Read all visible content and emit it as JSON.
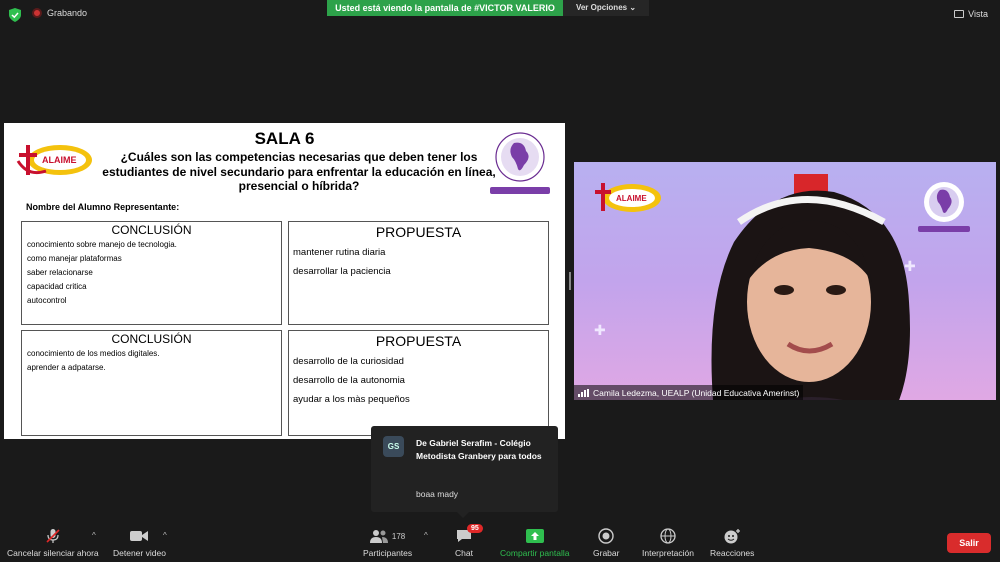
{
  "topbar": {
    "recording_label": "Grabando",
    "share_banner": "Usted está viendo la pantalla de #VICTOR VALERIO",
    "view_options": "Ver Opciones",
    "view_label": "Vista"
  },
  "slide": {
    "title": "SALA 6",
    "question": "¿Cuáles son las competencias necesarias que deben tener los estudiantes de nivel secundario para enfrentar la educación en línea, presencial o híbrida?",
    "logo_text": "ALAIME",
    "student_label": "Nombre del Alumno Representante:",
    "boxes": [
      {
        "heading": "CONCLUSIÓN",
        "lines": [
          "conocimiento sobre manejo de tecnologia.",
          "como manejar plataformas",
          "saber relacionarse",
          "capacidad critica",
          "autocontrol"
        ]
      },
      {
        "heading": "PROPUESTA",
        "lines": [
          "mantener rutina diaria",
          "desarrollar la paciencia"
        ]
      },
      {
        "heading": "CONCLUSIÓN",
        "lines": [
          "conocimiento de los medios digitales.",
          "aprender a adpatarse."
        ]
      },
      {
        "heading": "PROPUESTA",
        "lines": [
          "desarrollo de la curiosidad",
          "desarrollo de la autonomia",
          "ayudar a los màs pequeños"
        ]
      }
    ]
  },
  "video": {
    "participant_name": "Camila Ledezma, UEALP (Unidad Educativa Amerinst)",
    "logo_text": "ALAIME"
  },
  "chat_popup": {
    "avatar_initials": "GS",
    "from": "De Gabriel Serafim - Colégio Metodista Granbery para todos",
    "message": "boaa mady"
  },
  "toolbar": {
    "mute": "Cancelar silenciar ahora",
    "video": "Detener video",
    "participants": "Participantes",
    "participants_count": "178",
    "chat": "Chat",
    "chat_badge": "95",
    "share": "Compartir pantalla",
    "record": "Grabar",
    "interpretation": "Interpretación",
    "reactions": "Reacciones",
    "leave": "Salir"
  },
  "colors": {
    "share_green": "#2da24a",
    "leave_red": "#d92c2c",
    "badge_red": "#e02828"
  }
}
